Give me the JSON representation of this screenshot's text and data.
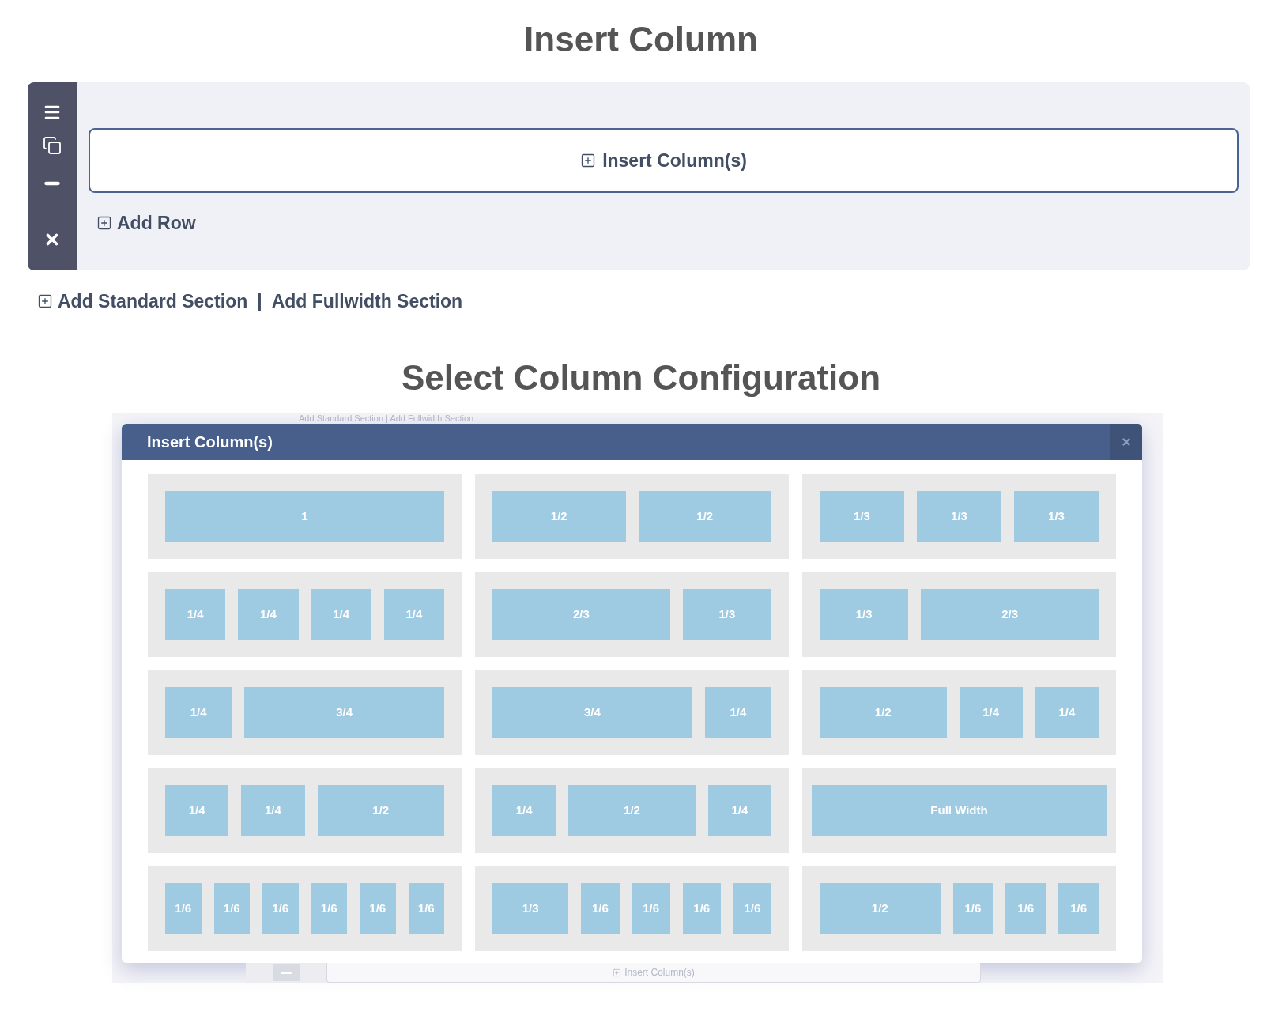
{
  "heading": "Insert Column",
  "builder": {
    "insert_button": "Insert Column(s)",
    "add_row": "Add Row"
  },
  "section_links": {
    "standard": "Add Standard Section",
    "separator": "|",
    "fullwidth": "Add Fullwidth Section"
  },
  "subheading": "Select Column Configuration",
  "backdrop": {
    "section_links": "Add Standard Section | Add Fullwidth Section",
    "insert_button": "Insert Column(s)"
  },
  "dialog": {
    "title": "Insert Column(s)",
    "options": [
      {
        "kind": "standard",
        "columns": [
          {
            "label": "1",
            "kind": "whole"
          }
        ]
      },
      {
        "kind": "standard",
        "columns": [
          {
            "label": "1/2",
            "kind": "half"
          },
          {
            "label": "1/2",
            "kind": "half"
          }
        ]
      },
      {
        "kind": "standard",
        "columns": [
          {
            "label": "1/3",
            "kind": "third"
          },
          {
            "label": "1/3",
            "kind": "third"
          },
          {
            "label": "1/3",
            "kind": "third"
          }
        ]
      },
      {
        "kind": "standard",
        "columns": [
          {
            "label": "1/4",
            "kind": "quarter"
          },
          {
            "label": "1/4",
            "kind": "quarter"
          },
          {
            "label": "1/4",
            "kind": "quarter"
          },
          {
            "label": "1/4",
            "kind": "quarter"
          }
        ]
      },
      {
        "kind": "standard",
        "columns": [
          {
            "label": "2/3",
            "kind": "two-thirds"
          },
          {
            "label": "1/3",
            "kind": "third"
          }
        ]
      },
      {
        "kind": "standard",
        "columns": [
          {
            "label": "1/3",
            "kind": "third"
          },
          {
            "label": "2/3",
            "kind": "two-thirds"
          }
        ]
      },
      {
        "kind": "standard",
        "columns": [
          {
            "label": "1/4",
            "kind": "quarter"
          },
          {
            "label": "3/4",
            "kind": "three-quarters"
          }
        ]
      },
      {
        "kind": "standard",
        "columns": [
          {
            "label": "3/4",
            "kind": "three-quarters"
          },
          {
            "label": "1/4",
            "kind": "quarter"
          }
        ]
      },
      {
        "kind": "standard",
        "columns": [
          {
            "label": "1/2",
            "kind": "half"
          },
          {
            "label": "1/4",
            "kind": "quarter"
          },
          {
            "label": "1/4",
            "kind": "quarter"
          }
        ]
      },
      {
        "kind": "standard",
        "columns": [
          {
            "label": "1/4",
            "kind": "quarter"
          },
          {
            "label": "1/4",
            "kind": "quarter"
          },
          {
            "label": "1/2",
            "kind": "half"
          }
        ]
      },
      {
        "kind": "standard",
        "columns": [
          {
            "label": "1/4",
            "kind": "quarter"
          },
          {
            "label": "1/2",
            "kind": "half"
          },
          {
            "label": "1/4",
            "kind": "quarter"
          }
        ]
      },
      {
        "kind": "fullwidth",
        "columns": [
          {
            "label": "Full Width",
            "kind": "whole"
          }
        ]
      },
      {
        "kind": "standard",
        "columns": [
          {
            "label": "1/6",
            "kind": "sixth"
          },
          {
            "label": "1/6",
            "kind": "sixth"
          },
          {
            "label": "1/6",
            "kind": "sixth"
          },
          {
            "label": "1/6",
            "kind": "sixth"
          },
          {
            "label": "1/6",
            "kind": "sixth"
          },
          {
            "label": "1/6",
            "kind": "sixth"
          }
        ]
      },
      {
        "kind": "standard",
        "columns": [
          {
            "label": "1/3",
            "kind": "third"
          },
          {
            "label": "1/6",
            "kind": "sixth"
          },
          {
            "label": "1/6",
            "kind": "sixth"
          },
          {
            "label": "1/6",
            "kind": "sixth"
          },
          {
            "label": "1/6",
            "kind": "sixth"
          }
        ]
      },
      {
        "kind": "standard",
        "columns": [
          {
            "label": "1/2",
            "kind": "half"
          },
          {
            "label": "1/6",
            "kind": "sixth"
          },
          {
            "label": "1/6",
            "kind": "sixth"
          },
          {
            "label": "1/6",
            "kind": "sixth"
          }
        ]
      }
    ]
  }
}
